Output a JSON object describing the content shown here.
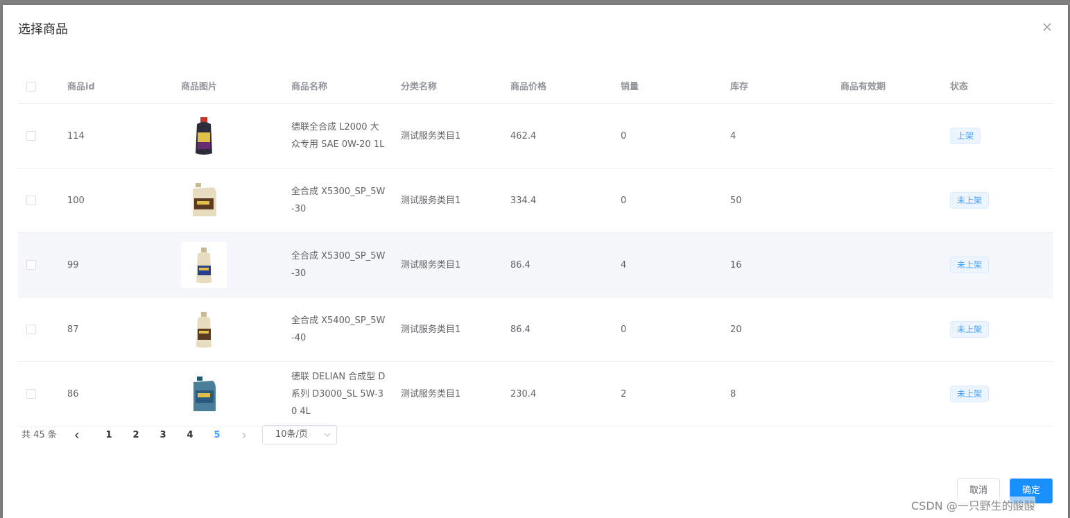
{
  "dialog": {
    "title": "选择商品",
    "close_icon": "close-icon"
  },
  "table": {
    "headers": {
      "id": "商品id",
      "image": "商品图片",
      "name": "商品名称",
      "category": "分类名称",
      "price": "商品价格",
      "sales": "销量",
      "stock": "库存",
      "expire": "商品有效期",
      "status": "状态"
    },
    "rows": [
      {
        "id": "114",
        "image_icon": "oil-bottle-dark-icon",
        "name": "德联全合成 L2000 大众专用 SAE 0W-20 1L",
        "category": "测试服务类目1",
        "price": "462.4",
        "sales": "0",
        "stock": "4",
        "expire": "",
        "status": "上架"
      },
      {
        "id": "100",
        "image_icon": "oil-jug-cream-icon",
        "name": "全合成 X5300_SP_5W-30",
        "category": "测试服务类目1",
        "price": "334.4",
        "sales": "0",
        "stock": "50",
        "expire": "",
        "status": "未上架"
      },
      {
        "id": "99",
        "image_icon": "oil-bottle-cream-icon",
        "name": "全合成 X5300_SP_5W-30",
        "category": "测试服务类目1",
        "price": "86.4",
        "sales": "4",
        "stock": "16",
        "expire": "",
        "status": "未上架"
      },
      {
        "id": "87",
        "image_icon": "oil-bottle-cream-icon",
        "name": "全合成 X5400_SP_5W-40",
        "category": "测试服务类目1",
        "price": "86.4",
        "sales": "0",
        "stock": "20",
        "expire": "",
        "status": "未上架"
      },
      {
        "id": "86",
        "image_icon": "oil-jug-blue-icon",
        "name": "德联 DELIAN 合成型 D系列 D3000_SL 5W-30 4L",
        "category": "测试服务类目1",
        "price": "230.4",
        "sales": "2",
        "stock": "8",
        "expire": "",
        "status": "未上架"
      }
    ]
  },
  "pagination": {
    "total": "共 45 条",
    "pages": [
      "1",
      "2",
      "3",
      "4",
      "5"
    ],
    "current": "5",
    "page_size": "10条/页"
  },
  "footer": {
    "cancel_label": "取消",
    "ok_label": "确定"
  },
  "watermark": "CSDN @一只野生的酸酸",
  "colors": {
    "primary": "#409eff",
    "button_primary": "#1890ff",
    "tag_bg": "#ecf5ff"
  }
}
